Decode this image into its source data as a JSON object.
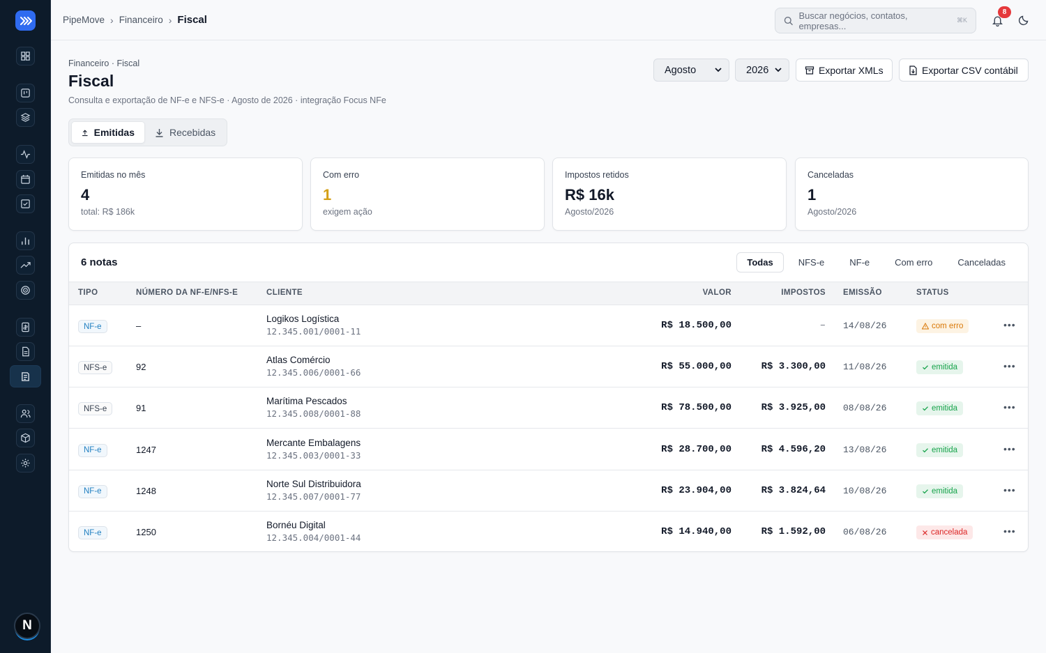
{
  "app": {
    "name": "PipeMove",
    "accent": "#2f6bf0"
  },
  "topbar": {
    "breadcrumbs": [
      "PipeMove",
      "Financeiro",
      "Fiscal"
    ],
    "search_placeholder": "Buscar negócios, contatos, empresas...",
    "search_shortcut": "⌘K",
    "notifications": "8"
  },
  "sidebar": {
    "avatar_letter": "N",
    "items": [
      "dashboard-icon",
      "board-icon",
      "layers-icon",
      "activity-icon",
      "calendar-icon",
      "task-icon",
      "bar-chart-icon",
      "trending-icon",
      "target-icon",
      "invoice-icon",
      "document-icon",
      "fiscal-icon",
      "users-icon",
      "package-icon",
      "settings-icon"
    ],
    "active": "fiscal-icon"
  },
  "header": {
    "crumb": "Financeiro · Fiscal",
    "title": "Fiscal",
    "subtitle": "Consulta e exportação de NF-e e NFS-e · Agosto de 2026 · integração Focus NFe",
    "month": "Agosto",
    "year": "2026",
    "export_xml": "Exportar XMLs",
    "export_csv": "Exportar CSV contábil"
  },
  "tabs": [
    {
      "label": "Emitidas",
      "active": true
    },
    {
      "label": "Recebidas",
      "active": false
    }
  ],
  "stats": [
    {
      "label": "Emitidas no mês",
      "value": "4",
      "sub": "total: R$ 186k",
      "color": "#111827"
    },
    {
      "label": "Com erro",
      "value": "1",
      "sub": "exigem ação",
      "color": "#d4a017"
    },
    {
      "label": "Impostos retidos",
      "value": "R$ 16k",
      "sub": "Agosto/2026",
      "color": "#111827"
    },
    {
      "label": "Canceladas",
      "value": "1",
      "sub": "Agosto/2026",
      "color": "#111827"
    }
  ],
  "table": {
    "title": "6 notas",
    "filters": [
      "Todas",
      "NFS-e",
      "NF-e",
      "Com erro",
      "Canceladas"
    ],
    "active_filter": "Todas",
    "columns": [
      "TIPO",
      "NÚMERO DA NF-E/NFS-E",
      "CLIENTE",
      "VALOR",
      "IMPOSTOS",
      "EMISSÃO",
      "STATUS"
    ],
    "rows": [
      {
        "tipo": "NF-e",
        "numero": "–",
        "cliente": "Logikos Logística",
        "cnpj": "12.345.001/0001-11",
        "valor": "R$ 18.500,00",
        "impostos": "–",
        "emissao": "14/08/26",
        "status": "com erro",
        "status_kind": "erro"
      },
      {
        "tipo": "NFS-e",
        "numero": "92",
        "cliente": "Atlas Comércio",
        "cnpj": "12.345.006/0001-66",
        "valor": "R$ 55.000,00",
        "impostos": "R$ 3.300,00",
        "emissao": "11/08/26",
        "status": "emitida",
        "status_kind": "ok"
      },
      {
        "tipo": "NFS-e",
        "numero": "91",
        "cliente": "Marítima Pescados",
        "cnpj": "12.345.008/0001-88",
        "valor": "R$ 78.500,00",
        "impostos": "R$ 3.925,00",
        "emissao": "08/08/26",
        "status": "emitida",
        "status_kind": "ok"
      },
      {
        "tipo": "NF-e",
        "numero": "1247",
        "cliente": "Mercante Embalagens",
        "cnpj": "12.345.003/0001-33",
        "valor": "R$ 28.700,00",
        "impostos": "R$ 4.596,20",
        "emissao": "13/08/26",
        "status": "emitida",
        "status_kind": "ok"
      },
      {
        "tipo": "NF-e",
        "numero": "1248",
        "cliente": "Norte Sul Distribuidora",
        "cnpj": "12.345.007/0001-77",
        "valor": "R$ 23.904,00",
        "impostos": "R$ 3.824,64",
        "emissao": "10/08/26",
        "status": "emitida",
        "status_kind": "ok"
      },
      {
        "tipo": "NF-e",
        "numero": "1250",
        "cliente": "Bornéu Digital",
        "cnpj": "12.345.004/0001-44",
        "valor": "R$ 14.940,00",
        "impostos": "R$ 1.592,00",
        "emissao": "06/08/26",
        "status": "cancelada",
        "status_kind": "canc"
      }
    ]
  }
}
